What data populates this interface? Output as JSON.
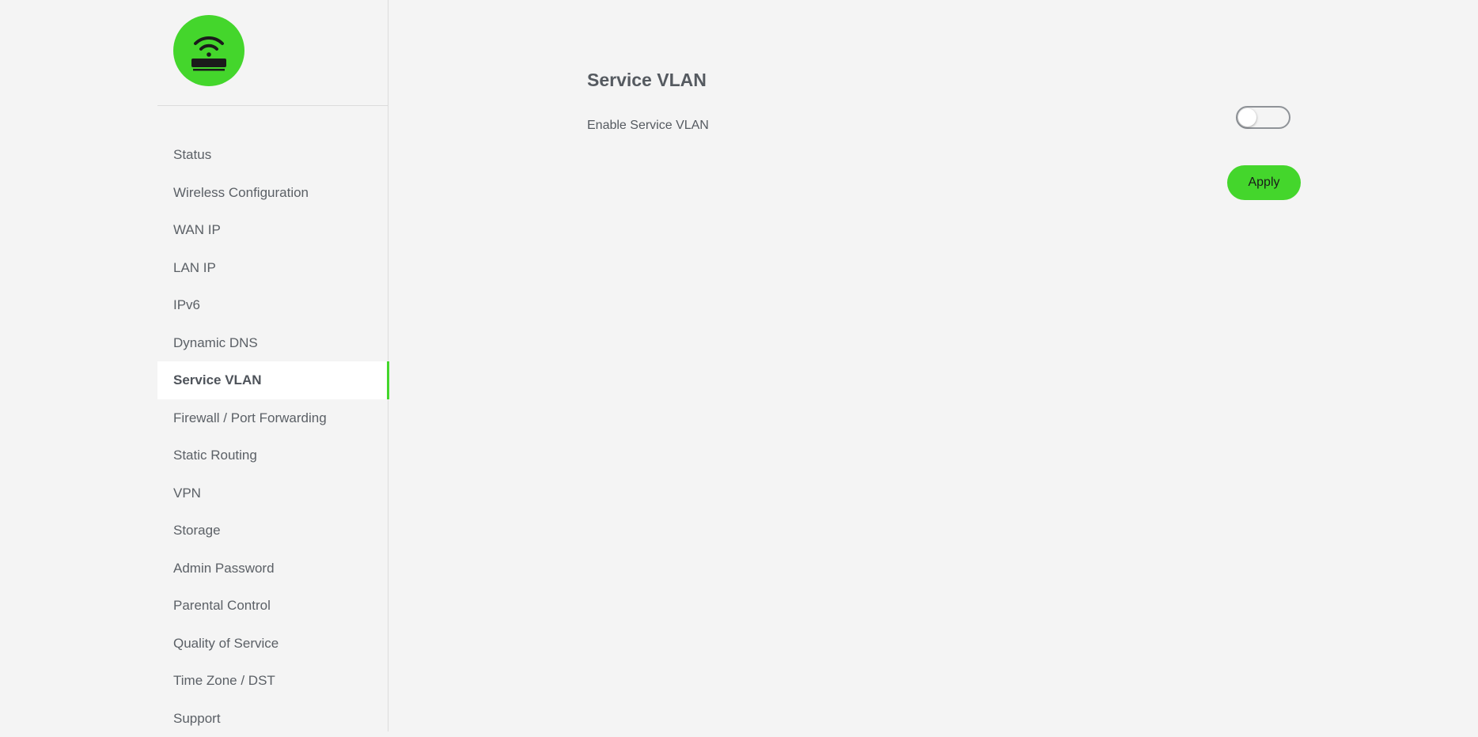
{
  "logo": {
    "icon": "router-wifi-icon",
    "color": "#44d62c"
  },
  "sidebar": {
    "items": [
      {
        "label": "Status"
      },
      {
        "label": "Wireless Configuration"
      },
      {
        "label": "WAN IP"
      },
      {
        "label": "LAN IP"
      },
      {
        "label": "IPv6"
      },
      {
        "label": "Dynamic DNS"
      },
      {
        "label": "Service VLAN",
        "active": true
      },
      {
        "label": "Firewall / Port Forwarding"
      },
      {
        "label": "Static Routing"
      },
      {
        "label": "VPN"
      },
      {
        "label": "Storage"
      },
      {
        "label": "Admin Password"
      },
      {
        "label": "Parental Control"
      },
      {
        "label": "Quality of Service"
      },
      {
        "label": "Time Zone / DST"
      },
      {
        "label": "Support"
      }
    ]
  },
  "main": {
    "title": "Service VLAN",
    "enable_label": "Enable Service VLAN",
    "enable_value": false,
    "apply_label": "Apply"
  },
  "colors": {
    "accent": "#44d62c",
    "background": "#f4f4f4",
    "text": "#555a60"
  }
}
